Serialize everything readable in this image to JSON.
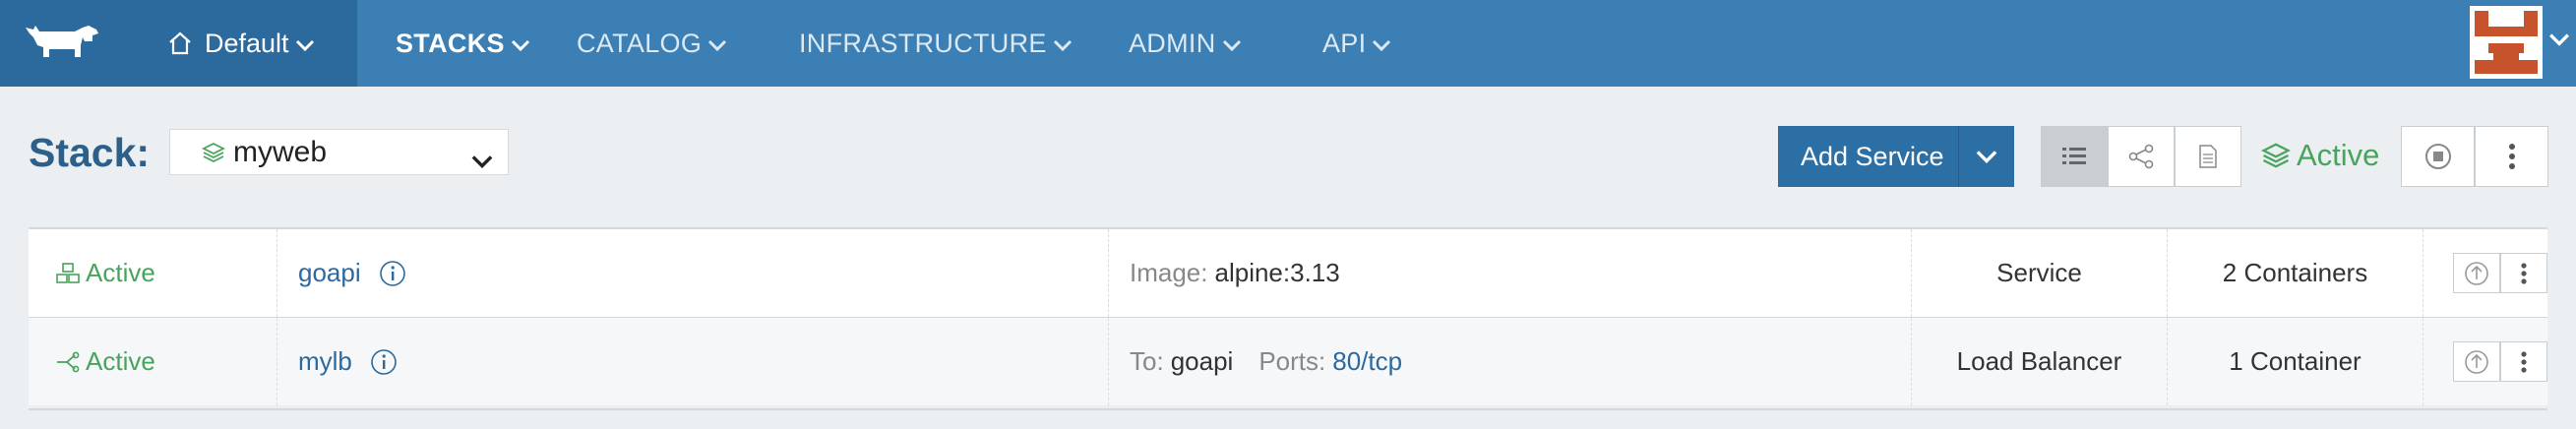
{
  "nav": {
    "environment": "Default",
    "items": [
      {
        "label": "STACKS",
        "active": true
      },
      {
        "label": "CATALOG",
        "active": false
      },
      {
        "label": "INFRASTRUCTURE",
        "active": false
      },
      {
        "label": "ADMIN",
        "active": false
      },
      {
        "label": "API",
        "active": false
      }
    ],
    "icons": {
      "logo": "rancher-cow-logo",
      "home": "home-icon",
      "avatar": "user-avatar"
    }
  },
  "stack": {
    "label": "Stack:",
    "selected": "myweb",
    "add_service": "Add Service",
    "state": "Active",
    "view_modes": [
      "list-icon",
      "graph-icon",
      "compose-file-icon"
    ],
    "actions": [
      "stop-icon",
      "more-options-icon"
    ]
  },
  "services": [
    {
      "state": "Active",
      "state_icon": "service-icon",
      "name": "goapi",
      "detail_label": "Image:",
      "detail_value": "alpine:3.13",
      "type": "Service",
      "containers": "2 Containers"
    },
    {
      "state": "Active",
      "state_icon": "load-balancer-icon",
      "name": "mylb",
      "detail_label": "To:",
      "detail_value": "goapi",
      "ports_label": "Ports:",
      "ports_value": "80/tcp",
      "type": "Load Balancer",
      "containers": "1 Container"
    }
  ],
  "colors": {
    "nav_bg": "#3b7fb5",
    "nav_dark": "#2c6a9d",
    "active_green": "#47a45c",
    "link_blue": "#2c6a9d",
    "primary_button": "#2c6fa5"
  }
}
